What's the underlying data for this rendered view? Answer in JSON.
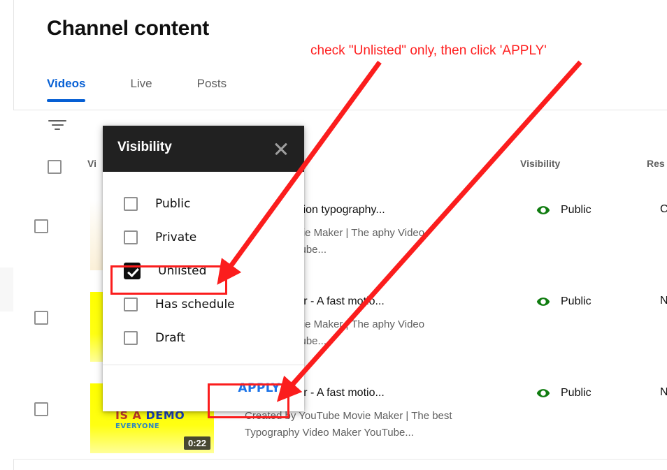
{
  "page": {
    "title": "Channel content"
  },
  "tabs": [
    {
      "label": "Videos",
      "active": true
    },
    {
      "label": "Live",
      "active": false
    },
    {
      "label": "Posts",
      "active": false
    }
  ],
  "filter": {
    "icon": "filter-icon"
  },
  "table": {
    "columns": {
      "video": "Vi",
      "visibility": "Visibility",
      "restrictions": "Res"
    },
    "rows": [
      {
        "title": "e a fast motion typography...",
        "description": "ouTube Movie Maker | The aphy Video Maker YouTube...",
        "visibility": "Public",
        "visibility_icon": "eye-icon",
        "restrictions": "Cop",
        "thumb_style": "cream",
        "duration": ""
      },
      {
        "title": "Video Maker - A fast motio...",
        "description": "ouTube Movie Maker | The aphy Video Maker YouTube...",
        "visibility": "Public",
        "visibility_icon": "eye-icon",
        "restrictions": "Non",
        "thumb_style": "yellow",
        "duration": ""
      },
      {
        "title": "Video Maker - A fast motio...",
        "description": "Created by YouTube Movie Maker | The best Typography Video Maker YouTube...",
        "visibility": "Public",
        "visibility_icon": "eye-icon",
        "restrictions": "Non",
        "thumb_style": "yellow",
        "duration": "0:22",
        "thumb_line1_a": "IS A ",
        "thumb_line1_b": "DEMO",
        "thumb_line2": "EVERYONE"
      }
    ]
  },
  "dialog": {
    "title": "Visibility",
    "close_icon": "close-icon",
    "options": [
      {
        "label": "Public",
        "checked": false
      },
      {
        "label": "Private",
        "checked": false
      },
      {
        "label": "Unlisted",
        "checked": true
      },
      {
        "label": "Has schedule",
        "checked": false
      },
      {
        "label": "Draft",
        "checked": false
      }
    ],
    "apply_label": "APPLY"
  },
  "annotation": {
    "text": "check \"Unlisted\" only, then click 'APPLY'",
    "color": "#ff2020"
  },
  "colors": {
    "accent_blue": "#065fd4",
    "apply_blue": "#1a73e8",
    "public_green": "#107c10",
    "dialog_header": "#212121",
    "annotation_red": "#ff2020"
  }
}
